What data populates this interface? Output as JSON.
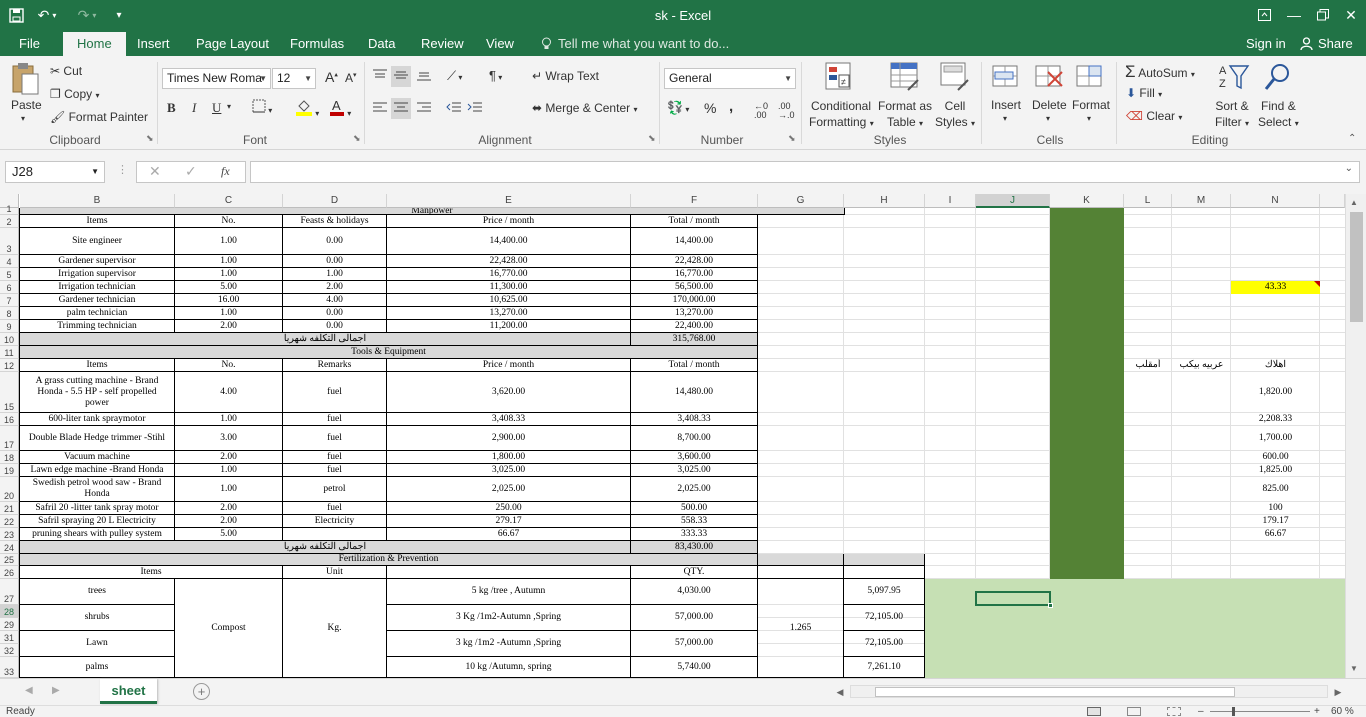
{
  "window": {
    "title": "sk - Excel",
    "sign_in": "Sign in",
    "share": "Share"
  },
  "tabs": {
    "file": "File",
    "home": "Home",
    "insert": "Insert",
    "page_layout": "Page Layout",
    "formulas": "Formulas",
    "data": "Data",
    "review": "Review",
    "view": "View",
    "tell_me": "Tell me what you want to do..."
  },
  "ribbon": {
    "clipboard": {
      "paste": "Paste",
      "cut": "Cut",
      "copy": "Copy",
      "format_painter": "Format Painter",
      "label": "Clipboard"
    },
    "font": {
      "name": "Times New Roma",
      "size": "12",
      "bold": "B",
      "italic": "I",
      "underline": "U",
      "label": "Font"
    },
    "alignment": {
      "wrap_text": "Wrap Text",
      "merge_center": "Merge & Center",
      "label": "Alignment"
    },
    "number": {
      "format": "General",
      "percent": "%",
      "comma": ",",
      "label": "Number"
    },
    "styles": {
      "conditional": "Conditional",
      "conditional2": "Formatting",
      "format_as": "Format as",
      "format_as2": "Table",
      "cell": "Cell",
      "cell2": "Styles",
      "label": "Styles"
    },
    "cells": {
      "insert": "Insert",
      "delete": "Delete",
      "format": "Format",
      "label": "Cells"
    },
    "editing": {
      "autosum": "AutoSum",
      "fill": "Fill",
      "clear": "Clear",
      "sort": "Sort &",
      "sort2": "Filter",
      "find": "Find &",
      "find2": "Select",
      "label": "Editing"
    }
  },
  "formula_bar": {
    "name_box": "J28",
    "fx": "fx",
    "value": ""
  },
  "columns": [
    "B",
    "C",
    "D",
    "E",
    "F",
    "G",
    "H",
    "I",
    "J",
    "K",
    "L",
    "M",
    "N"
  ],
  "selected_column": "J",
  "rows": [
    "1",
    "2",
    "3",
    "4",
    "5",
    "6",
    "7",
    "8",
    "9",
    "10",
    "11",
    "12",
    "15",
    "16",
    "17",
    "18",
    "19",
    "20",
    "21",
    "22",
    "23",
    "24",
    "25",
    "26",
    "27",
    "28",
    "29",
    "31",
    "32",
    "33"
  ],
  "selected_row": "28",
  "manpower": {
    "title": "Manpower",
    "headers": [
      "Items",
      "No.",
      "Feasts & holidays",
      "Price / month",
      "Total / month"
    ],
    "rows": [
      [
        "Site engineer",
        "1.00",
        "0.00",
        "14,400.00",
        "14,400.00"
      ],
      [
        "Gardener supervisor",
        "1.00",
        "0.00",
        "22,428.00",
        "22,428.00"
      ],
      [
        "Irrigation supervisor",
        "1.00",
        "1.00",
        "16,770.00",
        "16,770.00"
      ],
      [
        "Irrigation technician",
        "5.00",
        "2.00",
        "11,300.00",
        "56,500.00"
      ],
      [
        "Gardener technician",
        "16.00",
        "4.00",
        "10,625.00",
        "170,000.00"
      ],
      [
        "palm technician",
        "1.00",
        "0.00",
        "13,270.00",
        "13,270.00"
      ],
      [
        "Trimming technician",
        "2.00",
        "0.00",
        "11,200.00",
        "22,400.00"
      ]
    ],
    "total_label": "اجمالى التكلفه شهريا",
    "total": "315,768.00",
    "n6_value": "43.33"
  },
  "tools": {
    "title": "Tools & Equipment",
    "headers": [
      "Items",
      "No.",
      "Remarks",
      "Price / month",
      "Total / month"
    ],
    "arabic_headers": [
      "أمقلب",
      "عربيه بيكب",
      "اهلاك"
    ],
    "rows": [
      [
        "A grass cutting machine - Brand Honda - 5.5 HP - self propelled power",
        "4.00",
        "fuel",
        "3,620.00",
        "14,480.00",
        "1,820.00"
      ],
      [
        "600-liter tank spraymotor",
        "1.00",
        "fuel",
        "3,408.33",
        "3,408.33",
        "2,208.33"
      ],
      [
        "Double Blade Hedge trimmer -Stihl",
        "3.00",
        "fuel",
        "2,900.00",
        "8,700.00",
        "1,700.00"
      ],
      [
        "Vacuum machine",
        "2.00",
        "fuel",
        "1,800.00",
        "3,600.00",
        "600.00"
      ],
      [
        "Lawn edge machine -Brand Honda",
        "1.00",
        "fuel",
        "3,025.00",
        "3,025.00",
        "1,825.00"
      ],
      [
        "Swedish petrol wood saw - Brand Honda",
        "1.00",
        "petrol",
        "2,025.00",
        "2,025.00",
        "825.00"
      ],
      [
        "Safril 20 -litter tank spray motor",
        "2.00",
        "fuel",
        "250.00",
        "500.00",
        "100"
      ],
      [
        "Safril spraying 20 L Electricity",
        "2.00",
        "Electricity",
        "279.17",
        "558.33",
        "179.17"
      ],
      [
        "pruning shears with pulley system",
        "5.00",
        "",
        "66.67",
        "333.33",
        "66.67"
      ]
    ],
    "total_label": "اجمالى التكلفه شهريا",
    "total": "83,430.00"
  },
  "fertilization": {
    "title": "Fertilization & Prevention",
    "headers": [
      "Items",
      "Unit",
      "QTY."
    ],
    "material": "Compost",
    "unit": "Kg.",
    "factor": "1.265",
    "rows": [
      [
        "trees",
        "5 kg /tree , Autumn",
        "4,030.00",
        "5,097.95"
      ],
      [
        "shrubs",
        "3 Kg /1m2-Autumn ,Spring",
        "57,000.00",
        "72,105.00"
      ],
      [
        "Lawn",
        "3 kg /1m2 -Autumn ,Spring",
        "57,000.00",
        "72,105.00"
      ],
      [
        "palms",
        "10 kg /Autumn, spring",
        "5,740.00",
        "7,261.10"
      ]
    ]
  },
  "sheet_tab": "sheet",
  "status": {
    "ready": "Ready",
    "zoom": "60 %"
  },
  "colors": {
    "excel_green": "#217346",
    "green_block": "#548235",
    "light_green": "#c6e0b4",
    "yellow": "#ffff00",
    "gray_cell": "#d9d9d9"
  }
}
